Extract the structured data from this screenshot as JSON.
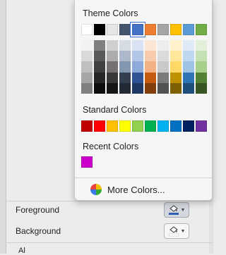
{
  "panel": {
    "foreground_label": "Foreground",
    "background_label": "Background",
    "bottom_text": "Al"
  },
  "popup": {
    "theme_title": "Theme Colors",
    "standard_title": "Standard Colors",
    "recent_title": "Recent Colors",
    "more_colors_label": "More Colors...",
    "selected_theme_index": 4
  },
  "theme_colors": [
    "#FFFFFF",
    "#000000",
    "#E7E6E6",
    "#44546A",
    "#4472C4",
    "#ED7D31",
    "#A5A5A5",
    "#FFC000",
    "#5B9BD5",
    "#70AD47"
  ],
  "theme_shades": [
    [
      "#F2F2F2",
      "#D9D9D9",
      "#BFBFBF",
      "#A6A6A6",
      "#808080"
    ],
    [
      "#808080",
      "#595959",
      "#404040",
      "#262626",
      "#0D0D0D"
    ],
    [
      "#D0CECE",
      "#AEABAB",
      "#757171",
      "#3B3838",
      "#171616"
    ],
    [
      "#D6DCE4",
      "#ADB9CA",
      "#8497B0",
      "#333F4F",
      "#222A35"
    ],
    [
      "#D9E2F3",
      "#B4C6E7",
      "#8EAADB",
      "#2F5496",
      "#1F3864"
    ],
    [
      "#FBE5D5",
      "#F7CBAC",
      "#F4B183",
      "#C55A11",
      "#833C0B"
    ],
    [
      "#EDEDED",
      "#DBDBDB",
      "#C9C9C9",
      "#7B7B7B",
      "#525252"
    ],
    [
      "#FFF2CC",
      "#FFE699",
      "#FFD966",
      "#BF9000",
      "#7F6000"
    ],
    [
      "#DEEBF6",
      "#BDD7EE",
      "#9DC3E6",
      "#2E75B5",
      "#1E4E79"
    ],
    [
      "#E2EFD9",
      "#C5E0B3",
      "#A8D08D",
      "#538135",
      "#375623"
    ]
  ],
  "standard_colors": [
    "#C00000",
    "#FF0000",
    "#FFC000",
    "#FFFF00",
    "#92D050",
    "#00B050",
    "#00B0F0",
    "#0070C0",
    "#002060",
    "#7030A0"
  ],
  "recent_colors": [
    "#CC00CC"
  ],
  "foreground_color": "#2E5FB5",
  "background_color": "#FFFFFF"
}
